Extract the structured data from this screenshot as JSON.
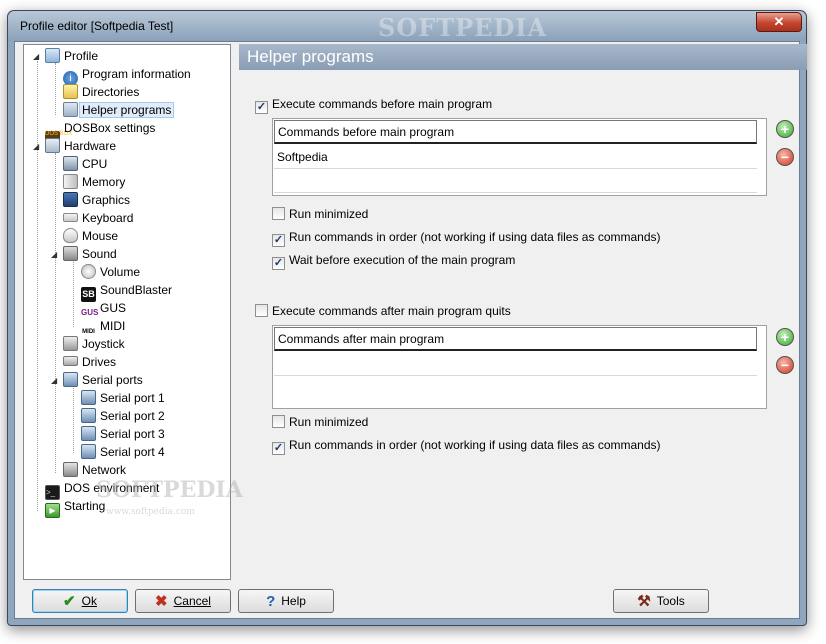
{
  "window": {
    "title": "Profile editor [Softpedia Test]",
    "close_glyph": "✕",
    "watermark": "SOFTPEDIA"
  },
  "tree": {
    "profile": "Profile",
    "program_information": "Program information",
    "directories": "Directories",
    "helper_programs": "Helper programs",
    "dosbox_settings": "DOSBox settings",
    "hardware": "Hardware",
    "cpu": "CPU",
    "memory": "Memory",
    "graphics": "Graphics",
    "keyboard": "Keyboard",
    "mouse": "Mouse",
    "sound": "Sound",
    "volume": "Volume",
    "soundblaster": "SoundBlaster",
    "gus": "GUS",
    "midi": "MIDI",
    "joystick": "Joystick",
    "drives": "Drives",
    "serial_ports": "Serial ports",
    "serial_port_1": "Serial port 1",
    "serial_port_2": "Serial port 2",
    "serial_port_3": "Serial port 3",
    "serial_port_4": "Serial port 4",
    "network": "Network",
    "dos_environment": "DOS environment",
    "starting": "Starting",
    "watermark_big": "SOFTPEDIA",
    "watermark_small": "www.softpedia.com"
  },
  "panel": {
    "header": "Helper programs",
    "before": {
      "execute_label": "Execute commands before main program",
      "execute_checked": true,
      "list_header": "Commands before main program",
      "rows": [
        "Softpedia"
      ],
      "run_minimized": "Run minimized",
      "run_minimized_checked": false,
      "run_in_order": "Run commands in order (not working if using data files as commands)",
      "run_in_order_checked": true,
      "wait_before": "Wait before execution of the main program",
      "wait_before_checked": true
    },
    "after": {
      "execute_label": "Execute commands after main program quits",
      "execute_checked": false,
      "list_header": "Commands after main program",
      "run_minimized": "Run minimized",
      "run_minimized_checked": false,
      "run_in_order": "Run commands in order (not working if using data files as commands)",
      "run_in_order_checked": true
    },
    "add_glyph": "+",
    "remove_glyph": "−"
  },
  "buttons": {
    "ok": "Ok",
    "cancel": "Cancel",
    "help": "Help",
    "tools": "Tools",
    "ok_icon": "✔",
    "cancel_icon": "✖",
    "help_icon": "?",
    "tools_icon": "⚒"
  },
  "check_glyph": "✓",
  "colors": {
    "header_bg": "#8a9db4",
    "selected_bg": "#e1ecf9",
    "add": "#3ca12e",
    "remove": "#d2361e"
  }
}
